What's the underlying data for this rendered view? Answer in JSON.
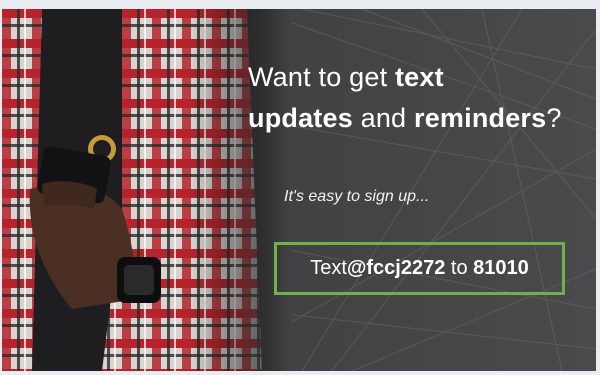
{
  "banner": {
    "headline_line1_prefix": "Want to get ",
    "headline_line1_bold": "text",
    "headline_line2_bold1": "updates",
    "headline_line2_mid": " and ",
    "headline_line2_bold2": "reminders",
    "headline_line2_suffix": "?",
    "subline": "It's easy to sign up...",
    "cta_prefix": "Text ",
    "cta_code": "@fccj2272",
    "cta_mid": " to ",
    "cta_number": "81010"
  },
  "colors": {
    "background": "#444446",
    "cta_border": "#6fb04a",
    "text": "#ffffff"
  }
}
